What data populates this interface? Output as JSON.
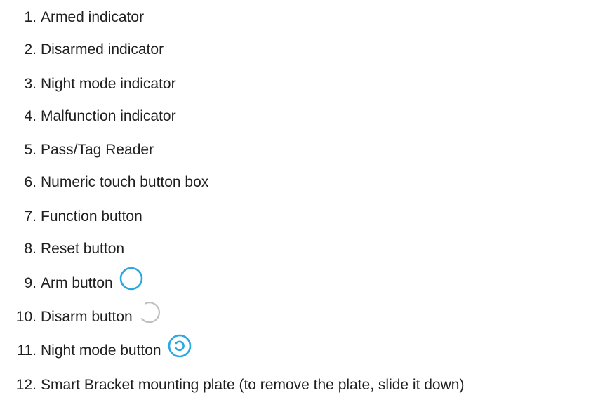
{
  "items": [
    {
      "number": "1.",
      "label": "Armed indicator"
    },
    {
      "number": "2.",
      "label": "Disarmed indicator"
    },
    {
      "number": "3.",
      "label": "Night mode indicator"
    },
    {
      "number": "4.",
      "label": "Malfunction indicator"
    },
    {
      "number": "5.",
      "label": "Pass/Tag Reader"
    },
    {
      "number": "6.",
      "label": "Numeric touch button box"
    },
    {
      "number": "7.",
      "label": "Function button"
    },
    {
      "number": "8.",
      "label": "Reset button"
    },
    {
      "number": "9.",
      "label": "Arm button",
      "icon": "arm-circle-icon",
      "icon_color": "#2aa8e0"
    },
    {
      "number": "10.",
      "label": "Disarm button",
      "icon": "disarm-partial-circle-icon",
      "icon_color": "#bfbfbf"
    },
    {
      "number": "11.",
      "label": "Night mode button",
      "icon": "night-mode-circle-icon",
      "icon_color": "#2aa8e0"
    },
    {
      "number": "12.",
      "label": "Smart Bracket mounting plate (to remove the plate, slide it down)"
    }
  ]
}
